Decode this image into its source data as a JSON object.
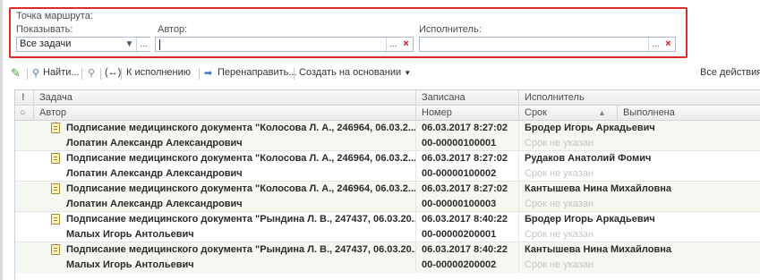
{
  "filter": {
    "route_point_label": "Точка маршрута:",
    "show_label": "Показывать:",
    "show_value": "Все задачи",
    "author_label": "Автор:",
    "author_value": "",
    "executor_label": "Исполнитель:",
    "executor_value": ""
  },
  "toolbar": {
    "find": "Найти...",
    "to_execution": "К исполнению",
    "redirect": "Перенаправить...",
    "create_based_on": "Создать на основании",
    "all_actions": "Все действия"
  },
  "table": {
    "headers_top": {
      "task": "Задача",
      "registered": "Записана",
      "executor": "Исполнитель"
    },
    "headers_bottom": {
      "author": "Автор",
      "number": "Номер",
      "deadline": "Срок",
      "done": "Выполнена"
    },
    "rows": [
      {
        "task": "Подписание медицинского документа \"Колосова Л. А., 246964, 06.03.2...",
        "author": "Лопатин Александр Александрович",
        "registered": "06.03.2017 8:27:02",
        "number": "00-00000100001",
        "executor": "Бродер Игорь Аркадьевич",
        "deadline": "Срок не указан"
      },
      {
        "task": "Подписание медицинского документа \"Колосова Л. А., 246964, 06.03.2...",
        "author": "Лопатин Александр Александрович",
        "registered": "06.03.2017 8:27:02",
        "number": "00-00000100002",
        "executor": "Рудаков Анатолий Фомич",
        "deadline": "Срок не указан"
      },
      {
        "task": "Подписание медицинского документа \"Колосова Л. А., 246964, 06.03.2...",
        "author": "Лопатин Александр Александрович",
        "registered": "06.03.2017 8:27:02",
        "number": "00-00000100003",
        "executor": "Кантышева Нина Михайловна",
        "deadline": "Срок не указан"
      },
      {
        "task": "Подписание медицинского документа \"Рындина Л. В., 247437, 06.03.20...",
        "author": "Малых Игорь Антольевич",
        "registered": "06.03.2017 8:40:22",
        "number": "00-00000200001",
        "executor": "Бродер Игорь Аркадьевич",
        "deadline": "Срок не указан"
      },
      {
        "task": "Подписание медицинского документа \"Рындина Л. В., 247437, 06.03.20...",
        "author": "Малых Игорь Антольевич",
        "registered": "06.03.2017 8:40:22",
        "number": "00-00000200002",
        "executor": "Кантышева Нина Михайловна",
        "deadline": "Срок не указан"
      }
    ]
  },
  "colors": {
    "highlight_border": "#e02a2a",
    "row_alt": "#f4f8f1",
    "muted_text": "#c4c4c4"
  }
}
